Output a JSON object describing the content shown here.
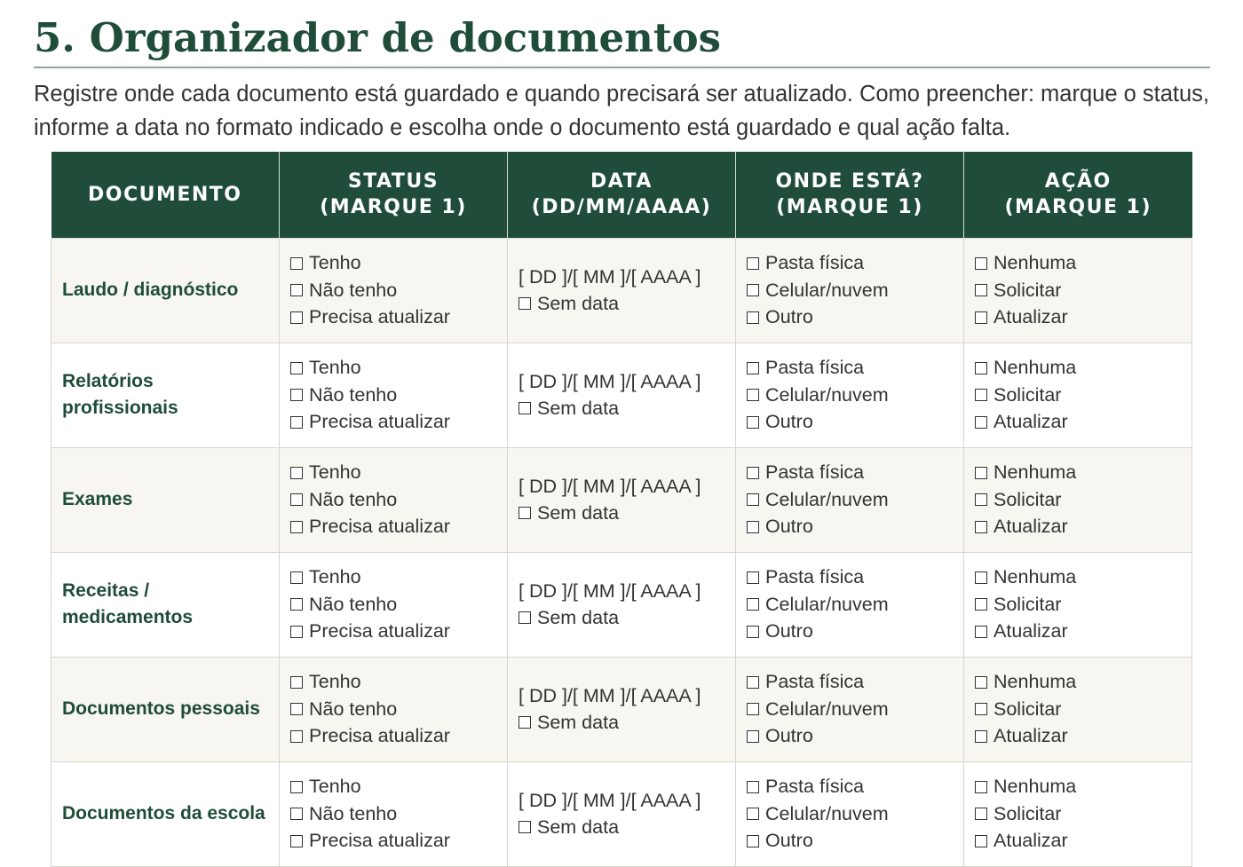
{
  "page": {
    "title": "5. Organizador de documentos",
    "intro": "Registre onde cada documento está guardado e quando precisará ser atualizado. Como preencher: marque o status, informe a data no formato indicado e escolha onde o documento está guardado e qual ação falta."
  },
  "table": {
    "headers": [
      {
        "line1": "DOCUMENTO",
        "line2": ""
      },
      {
        "line1": "STATUS",
        "line2": "(MARQUE 1)"
      },
      {
        "line1": "DATA",
        "line2": "(DD/MM/AAAA)"
      },
      {
        "line1": "ONDE ESTÁ?",
        "line2": "(MARQUE 1)"
      },
      {
        "line1": "AÇÃO",
        "line2": "(MARQUE 1)"
      }
    ],
    "status_options": [
      "Tenho",
      "Não tenho",
      "Precisa atualizar"
    ],
    "date_format": "[ DD ]/[ MM ]/[ AAAA ]",
    "date_none": "Sem data",
    "location_options": [
      "Pasta física",
      "Celular/nuvem",
      "Outro"
    ],
    "action_options": [
      "Nenhuma",
      "Solicitar",
      "Atualizar"
    ],
    "rows": [
      {
        "document": "Laudo / diagnóstico"
      },
      {
        "document": "Relatórios profissionais"
      },
      {
        "document": "Exames"
      },
      {
        "document": "Receitas / medicamentos"
      },
      {
        "document": "Documentos pessoais"
      },
      {
        "document": "Documentos da escola"
      }
    ]
  },
  "colors": {
    "accent": "#1f4d3a",
    "row_alt": "#f7f6f1"
  }
}
